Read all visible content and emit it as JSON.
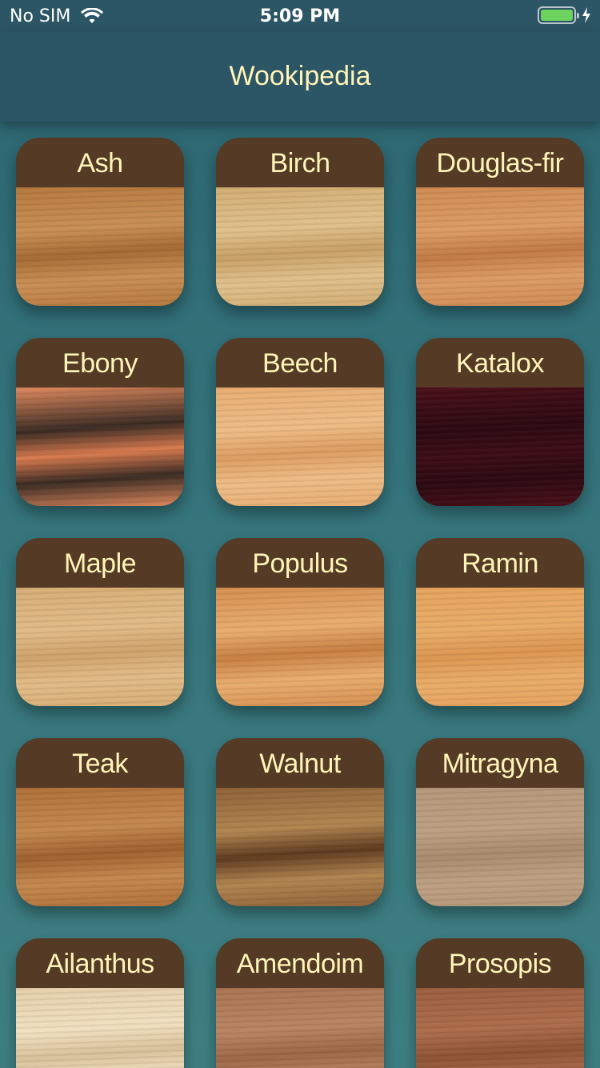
{
  "status_bar": {
    "carrier": "No SIM",
    "time": "5:09 PM",
    "battery_color": "#6ed35e"
  },
  "nav": {
    "title": "Wookipedia",
    "title_color": "#fff5b8",
    "bar_color": "#2c5565"
  },
  "woods": [
    {
      "name": "Ash",
      "colors": [
        "#b5783d",
        "#c98f55",
        "#a66a34"
      ]
    },
    {
      "name": "Birch",
      "colors": [
        "#d2ad73",
        "#e0c08b",
        "#c8a064"
      ]
    },
    {
      "name": "Douglas-fir",
      "colors": [
        "#cf8a52",
        "#dd9c66",
        "#c27a45"
      ]
    },
    {
      "name": "Ebony",
      "colors": [
        "#e0895d",
        "#3a2a22",
        "#d97a4e"
      ]
    },
    {
      "name": "Beech",
      "colors": [
        "#e7ad73",
        "#eebc85",
        "#dd9c60"
      ]
    },
    {
      "name": "Katalox",
      "colors": [
        "#4a0f1a",
        "#2b0910",
        "#3d0c16"
      ]
    },
    {
      "name": "Maple",
      "colors": [
        "#d6ad75",
        "#e2bb86",
        "#cfa36b"
      ]
    },
    {
      "name": "Populus",
      "colors": [
        "#d58f4f",
        "#e9ad6e",
        "#c87f41"
      ]
    },
    {
      "name": "Ramin",
      "colors": [
        "#e6a35d",
        "#e9ac68",
        "#dc9550"
      ]
    },
    {
      "name": "Teak",
      "colors": [
        "#b06f38",
        "#c4884f",
        "#9f612e"
      ]
    },
    {
      "name": "Walnut",
      "colors": [
        "#8f6138",
        "#b1854f",
        "#5e3a1f"
      ]
    },
    {
      "name": "Mitragyna",
      "colors": [
        "#b59779",
        "#bda083",
        "#a98b6d"
      ]
    },
    {
      "name": "Ailanthus",
      "colors": [
        "#e4cfaa",
        "#f1e0c0",
        "#d8c199"
      ]
    },
    {
      "name": "Amendoim",
      "colors": [
        "#a97451",
        "#b98462",
        "#9c6746"
      ]
    },
    {
      "name": "Prosopis",
      "colors": [
        "#9c5e3e",
        "#ad6d4b",
        "#8e5234"
      ]
    }
  ]
}
